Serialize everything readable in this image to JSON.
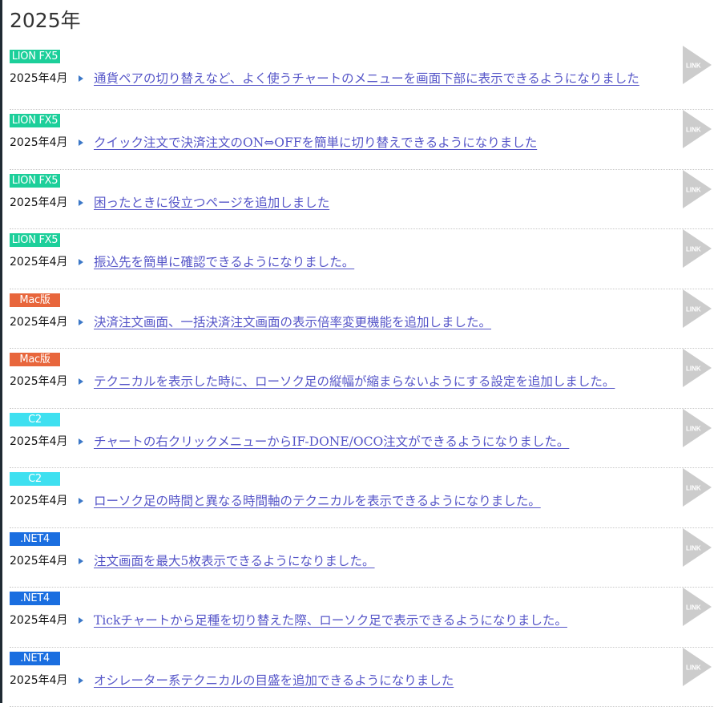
{
  "heading": "2025年",
  "link_icon_label": "LINK",
  "colors": {
    "lion": "#1ccf9a",
    "mac": "#e8663c",
    "c2": "#3ee0f0",
    "net4": "#1a6ee0",
    "link_icon": "#cccccc",
    "title_link": "#5555c8",
    "arrow": "#3c78c8"
  },
  "items": [
    {
      "badge": "LION FX5",
      "badge_type": "lion",
      "date": "2025年4月",
      "title": "通貨ペアの切り替えなど、よく使うチャートのメニューを画面下部に表示できるようになりました"
    },
    {
      "badge": "LION FX5",
      "badge_type": "lion",
      "date": "2025年4月",
      "title": "クイック注文で決済注文のON⇔OFFを簡単に切り替えできるようになりました"
    },
    {
      "badge": "LION FX5",
      "badge_type": "lion",
      "date": "2025年4月",
      "title": "困ったときに役立つページを追加しました"
    },
    {
      "badge": "LION FX5",
      "badge_type": "lion",
      "date": "2025年4月",
      "title": "振込先を簡単に確認できるようになりました。"
    },
    {
      "badge": "Mac版",
      "badge_type": "mac",
      "date": "2025年4月",
      "title": "決済注文画面、一括決済注文画面の表示倍率変更機能を追加しました。"
    },
    {
      "badge": "Mac版",
      "badge_type": "mac",
      "date": "2025年4月",
      "title": "テクニカルを表示した時に、ローソク足の縦幅が縮まらないようにする設定を追加しました。"
    },
    {
      "badge": "C2",
      "badge_type": "c2",
      "date": "2025年4月",
      "title": "チャートの右クリックメニューからIF-DONE/OCO注文ができるようになりました。"
    },
    {
      "badge": "C2",
      "badge_type": "c2",
      "date": "2025年4月",
      "title": "ローソク足の時間と異なる時間軸のテクニカルを表示できるようになりました。"
    },
    {
      "badge": ".NET4",
      "badge_type": "net4",
      "date": "2025年4月",
      "title": "注文画面を最大5枚表示できるようになりました。"
    },
    {
      "badge": ".NET4",
      "badge_type": "net4",
      "date": "2025年4月",
      "title": "Tickチャートから足種を切り替えた際、ローソク足で表示できるようになりました。"
    },
    {
      "badge": ".NET4",
      "badge_type": "net4",
      "date": "2025年4月",
      "title": "オシレーター系テクニカルの目盛を追加できるようになりました"
    }
  ]
}
